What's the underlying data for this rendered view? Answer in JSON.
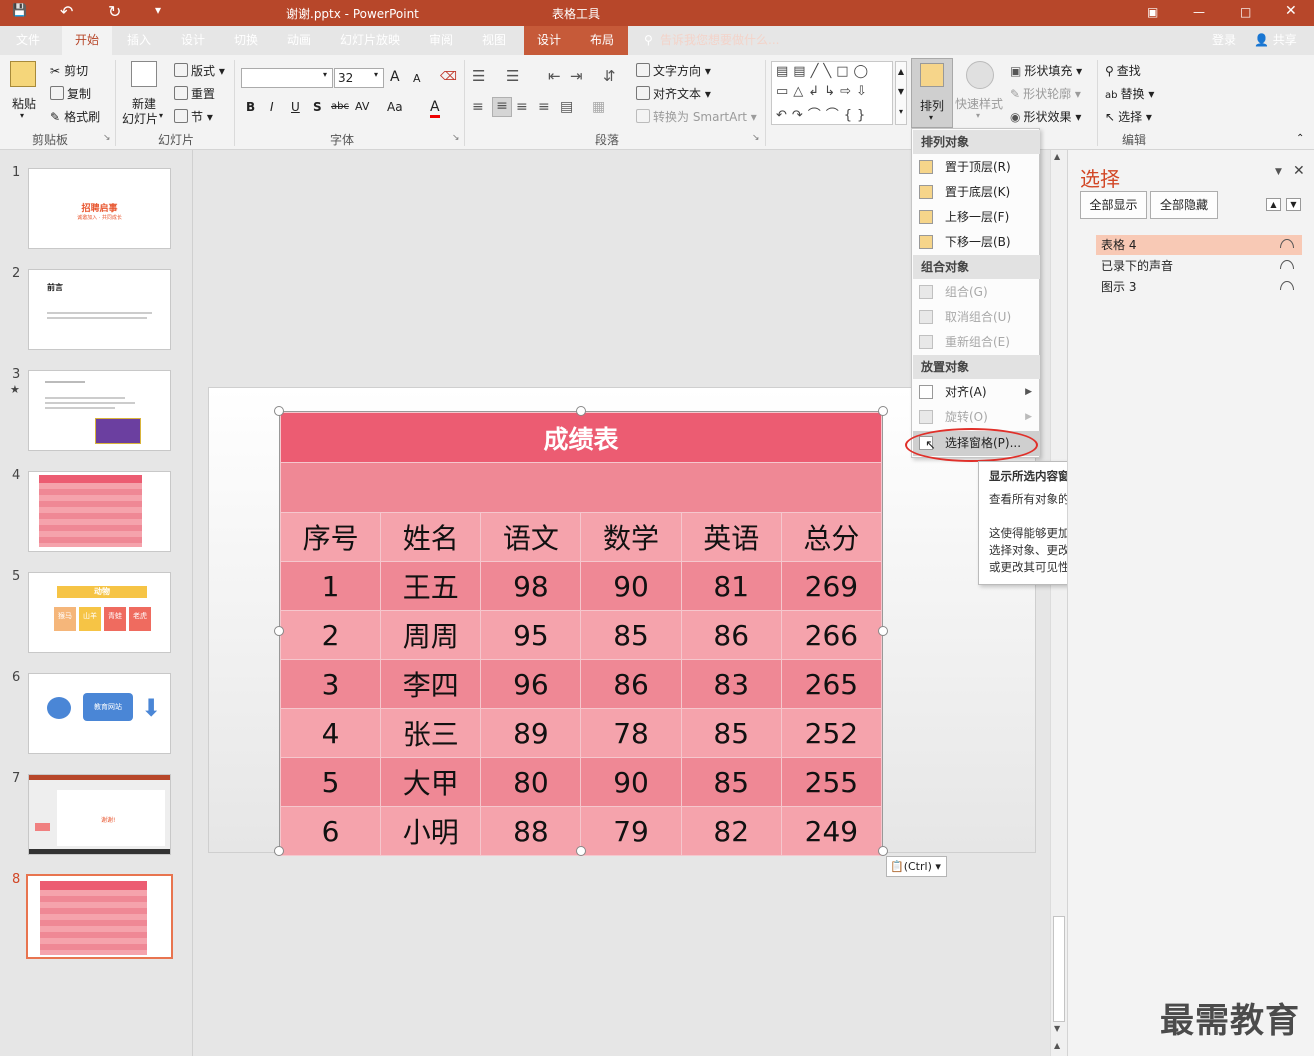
{
  "titlebar": {
    "filename": "谢谢.pptx - PowerPoint",
    "context_group": "表格工具"
  },
  "tabs": [
    "文件",
    "开始",
    "插入",
    "设计",
    "切换",
    "动画",
    "幻灯片放映",
    "审阅",
    "视图",
    "设计",
    "布局"
  ],
  "active_tab_index": 1,
  "search": {
    "placeholder": "告诉我您想要做什么..."
  },
  "account": {
    "login": "登录",
    "share": "共享"
  },
  "ribbon": {
    "clipboard": {
      "paste": "粘贴",
      "cut": "剪切",
      "copy": "复制",
      "format_painter": "格式刷",
      "label": "剪贴板"
    },
    "slides": {
      "new_slide_1": "新建",
      "new_slide_2": "幻灯片",
      "layout": "版式",
      "reset": "重置",
      "section": "节",
      "label": "幻灯片"
    },
    "font": {
      "font_size": "32",
      "bold": "B",
      "italic": "I",
      "underline": "U",
      "shadow": "S",
      "strike": "abc",
      "spacing": "AV",
      "case": "Aa",
      "color": "A",
      "grow": "A",
      "shrink": "A",
      "label": "字体"
    },
    "paragraph": {
      "text_direction": "文字方向",
      "align_text": "对齐文本",
      "smartart": "转换为 SmartArt",
      "label": "段落"
    },
    "drawing": {
      "arrange": "排列",
      "quick_styles": "快速样式",
      "shape_fill": "形状填充",
      "shape_outline": "形状轮廓",
      "shape_effects": "形状效果"
    },
    "editing": {
      "find": "查找",
      "replace": "替换",
      "select": "选择",
      "label": "编辑"
    }
  },
  "thumbnails": [
    {
      "num": "1",
      "title": "招聘启事",
      "sub": "诚邀加入 · 共同成长"
    },
    {
      "num": "2",
      "title": "前言"
    },
    {
      "num": "3",
      "star": "★"
    },
    {
      "num": "4"
    },
    {
      "num": "5",
      "title": "动物",
      "cells": [
        "猴马",
        "山羊",
        "青蛙",
        "老虎"
      ]
    },
    {
      "num": "6",
      "label": "教育网站"
    },
    {
      "num": "7",
      "label": "谢谢!"
    },
    {
      "num": "8"
    }
  ],
  "table": {
    "title": "成绩表",
    "headers": [
      "序号",
      "姓名",
      "语文",
      "数学",
      "英语",
      "总分"
    ],
    "rows": [
      [
        "1",
        "王五",
        "98",
        "90",
        "81",
        "269"
      ],
      [
        "2",
        "周周",
        "95",
        "85",
        "86",
        "266"
      ],
      [
        "3",
        "李四",
        "96",
        "86",
        "83",
        "265"
      ],
      [
        "4",
        "张三",
        "89",
        "78",
        "85",
        "252"
      ],
      [
        "5",
        "大甲",
        "80",
        "90",
        "85",
        "255"
      ],
      [
        "6",
        "小明",
        "88",
        "79",
        "82",
        "249"
      ]
    ]
  },
  "paste_options": "(Ctrl)",
  "arrange_menu": {
    "header_order": "排列对象",
    "bring_to_front": "置于顶层(R)",
    "send_to_back": "置于底层(K)",
    "bring_forward": "上移一层(F)",
    "send_backward": "下移一层(B)",
    "header_group": "组合对象",
    "group": "组合(G)",
    "ungroup": "取消组合(U)",
    "regroup": "重新组合(E)",
    "header_position": "放置对象",
    "align": "对齐(A)",
    "rotate": "旋转(O)",
    "selection_pane": "选择窗格(P)..."
  },
  "tooltip": {
    "title": "显示所选内容窗格",
    "line1": "查看所有对象的列表。",
    "line2": "这使得能够更加轻松地选择对象、更改其顺序或更改其可见性。"
  },
  "selection_pane": {
    "title": "选择",
    "show_all": "全部显示",
    "hide_all": "全部隐藏",
    "items": [
      "表格 4",
      "已录下的声音",
      "图示 3"
    ]
  },
  "watermark": "最需教育",
  "colors": {
    "accent": "#b7472a",
    "header": "#ec5c72",
    "row_light": "#f5a3ac",
    "row_dark": "#ef8895"
  }
}
